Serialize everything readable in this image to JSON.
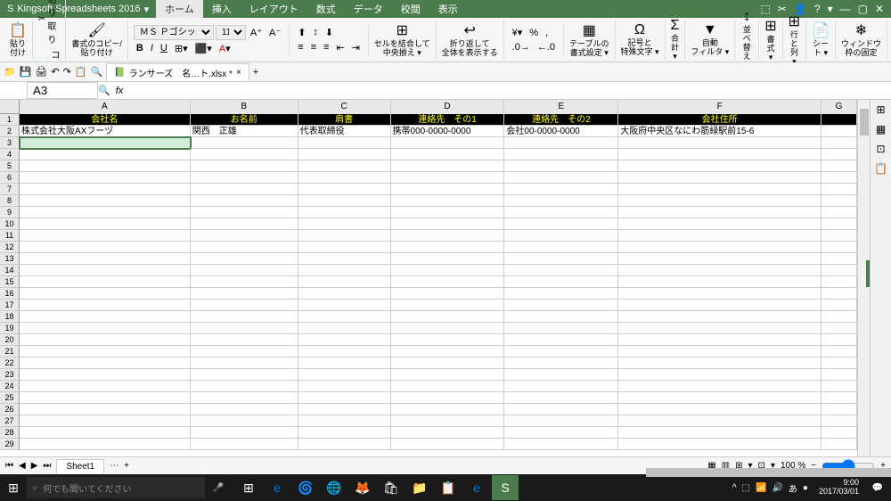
{
  "app": {
    "name": "Kingsoft Spreadsheets 2016"
  },
  "menu": {
    "tabs": [
      "ホーム",
      "挿入",
      "レイアウト",
      "数式",
      "データ",
      "校閲",
      "表示"
    ],
    "active": 0
  },
  "win_controls": [
    "⬚",
    "✂",
    "👤",
    "?",
    "▾",
    "—",
    "▢",
    "✕"
  ],
  "ribbon": {
    "paste": "貼り付け",
    "cut": "切り取り",
    "copy": "コピー",
    "format_copy": "書式のコピー/\n貼り付け",
    "font_name": "ＭＳ Ｐゴシック",
    "font_size": "11",
    "merge": "セルを結合して\n中央揃え ▾",
    "wrap": "折り返して\n全体を表示する",
    "table": "テーブルの\n書式設定 ▾",
    "symbol": "記号と\n特殊文字 ▾",
    "sum": "合計 ▾",
    "autofilter": "自動\nフィルタ ▾",
    "sort": "並べ替え ▾",
    "format": "書式 ▾",
    "rowcol": "行と列 ▾",
    "sheet": "シート ▾",
    "freeze": "ウィンドウ\n枠の固定"
  },
  "qat": {
    "file_tab": "ランサーズ　名…ト.xlsx *",
    "icons": [
      "📁",
      "💾",
      "🖨",
      "↶",
      "↷",
      "📋",
      "🔍"
    ]
  },
  "formula": {
    "cell_ref": "A3",
    "fx": "fx"
  },
  "columns": [
    "A",
    "B",
    "C",
    "D",
    "E",
    "F",
    "G"
  ],
  "headers": [
    "会社名",
    "お名前",
    "肩書",
    "連絡先　その1",
    "連絡先　その2",
    "会社住所"
  ],
  "data_row": [
    "株式会社大阪AXフーヅ",
    "関西　正雄",
    "代表取締役",
    "携帯000-0000-0000",
    "会社00-0000-0000",
    "大阪府中央区なにわ筋緑駅前15-6"
  ],
  "selected_cell": "A3",
  "row_count": 29,
  "sheet_tabs": {
    "active": "Sheet1",
    "add": "+",
    "menu": "⋯"
  },
  "status": {
    "zoom": "100 %",
    "icons": [
      "▦",
      "▥",
      "⊞",
      "▾",
      "⊡",
      "▾"
    ]
  },
  "taskbar": {
    "search_placeholder": "何でも聞いてください",
    "tray": [
      "^",
      "⬚",
      "📶",
      "🔊",
      "あ",
      "●"
    ],
    "time": "9:00",
    "date": "2017/03/01"
  }
}
